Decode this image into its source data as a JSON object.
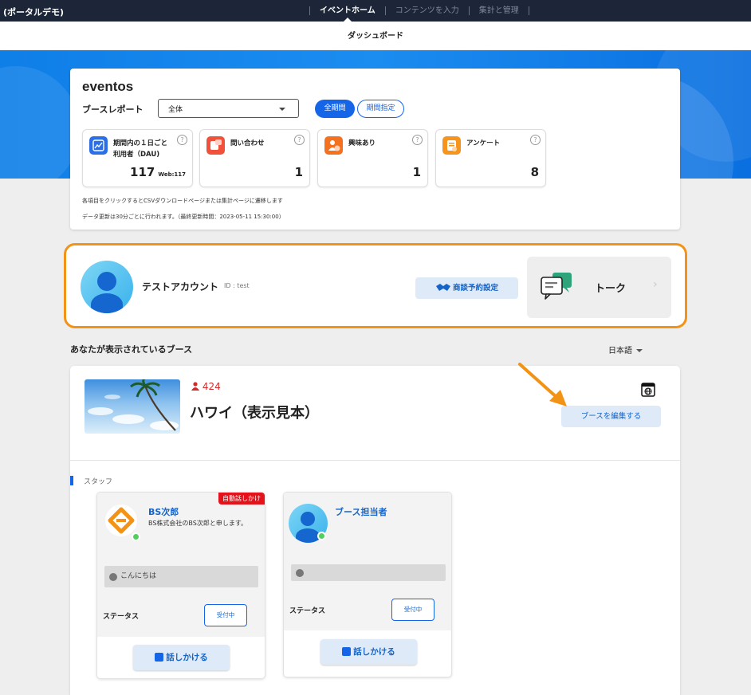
{
  "topbar": {
    "brand": "(ポータルデモ)",
    "nav": [
      "イベントホーム",
      "コンテンツを入力",
      "集計と管理"
    ]
  },
  "subbar": {
    "title": "ダッシュボード"
  },
  "report": {
    "logo": "eventos",
    "title": "ブースレポート",
    "select_value": "全体",
    "btn_all": "全期間",
    "btn_period": "期間指定",
    "stats": [
      {
        "label_line1": "期間内の１日ごと",
        "label_line2": "利用者（DAU)",
        "value": "117",
        "sub": "Web:117",
        "icon": "chart-icon",
        "color": "#2b6fe6"
      },
      {
        "label_line1": "問い合わせ",
        "label_line2": "",
        "value": "1",
        "sub": "",
        "icon": "inquiry-icon",
        "color": "#f0513a"
      },
      {
        "label_line1": "興味あり",
        "label_line2": "",
        "value": "1",
        "sub": "",
        "icon": "interest-icon",
        "color": "#f3711f"
      },
      {
        "label_line1": "アンケート",
        "label_line2": "",
        "value": "8",
        "sub": "",
        "icon": "survey-icon",
        "color": "#f7941e"
      }
    ],
    "note1": "各項目をクリックするとCSVダウンロードページまたは集計ページに遷移します",
    "note2": "データ更新は30分ごとに行われます。（最終更新時間：2023-05-11 15:30:00）"
  },
  "account": {
    "name": "テストアカウント",
    "id_text": "ID : test",
    "meeting_btn": "商談予約設定",
    "talk_label": "トーク"
  },
  "booths": {
    "title": "あなたが表示されているブース",
    "language": "日本語"
  },
  "booth": {
    "visits": "424",
    "name": "ハワイ（表示見本）",
    "edit_btn": "ブースを編集する",
    "staff_title": "スタッフ",
    "staff": [
      {
        "name": "BS次郎",
        "desc": "BS株式会社のBS次郎と申します。",
        "badge": "自動話しかけ",
        "message": "こんにちは",
        "status_label": "ステータス",
        "status_btn": "受付中",
        "talk_btn": "話しかける"
      },
      {
        "name": "ブース担当者",
        "desc": "",
        "badge": "",
        "message": "",
        "status_label": "ステータス",
        "status_btn": "受付中",
        "talk_btn": "話しかける"
      }
    ]
  },
  "colors": {
    "accent": "#1565e8",
    "highlight_border": "#f39316",
    "online": "#4fd15b",
    "badge": "#e3121b"
  }
}
